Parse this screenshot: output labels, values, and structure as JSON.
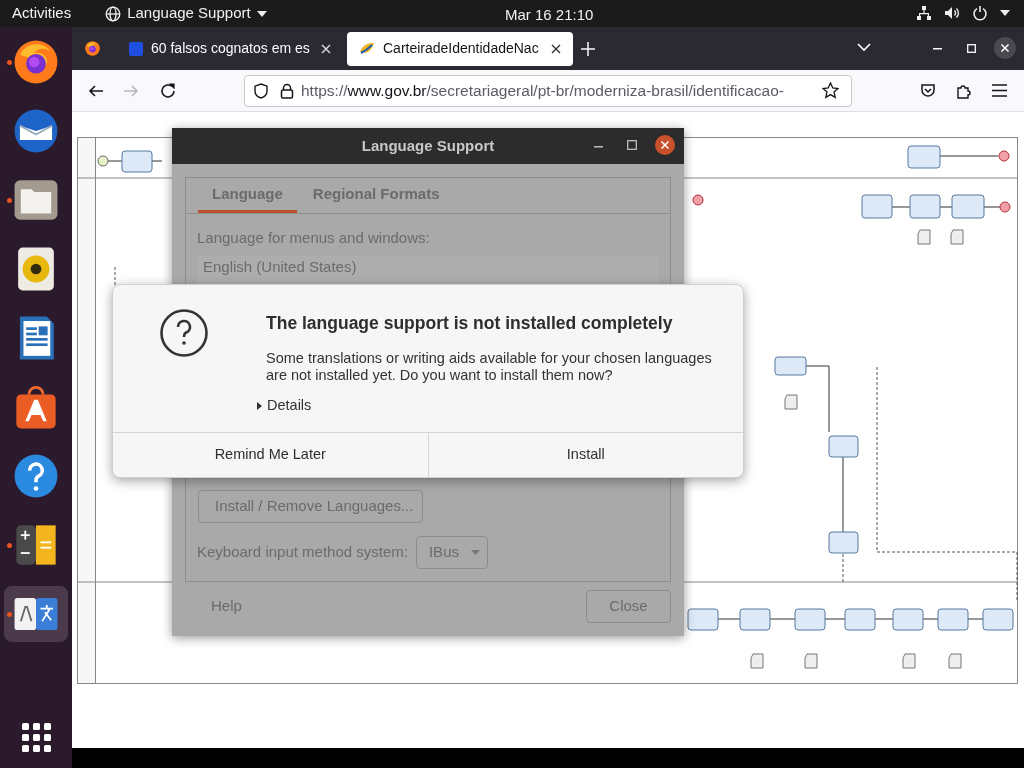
{
  "top_bar": {
    "activities": "Activities",
    "app_menu": "Language Support",
    "clock": "Mar 16  21:10"
  },
  "dock": {
    "items": [
      {
        "kind": "firefox",
        "running": true,
        "selected": false
      },
      {
        "kind": "mail",
        "running": false,
        "selected": false
      },
      {
        "kind": "files",
        "running": true,
        "selected": false
      },
      {
        "kind": "speaker",
        "running": false,
        "selected": false
      },
      {
        "kind": "document",
        "running": false,
        "selected": false
      },
      {
        "kind": "store",
        "running": false,
        "selected": false
      },
      {
        "kind": "help",
        "running": false,
        "selected": false
      },
      {
        "kind": "calculator",
        "running": true,
        "selected": false
      },
      {
        "kind": "language",
        "running": true,
        "selected": true
      }
    ]
  },
  "browser": {
    "tabs": [
      {
        "title": "60 falsos cognatos em es",
        "kind": "square",
        "selected": false
      },
      {
        "title": "CarteiradeIdentidadeNac",
        "kind": "leaf",
        "selected": true
      }
    ],
    "forward": {
      "disabled": true
    },
    "url": {
      "scheme": "https://",
      "host": "www.gov.br",
      "path": "/secretariageral/pt-br/moderniza-brasil/identificacao-"
    }
  },
  "language_window": {
    "title": "Language Support",
    "dimmed": true,
    "tabs": [
      {
        "label": "Language",
        "selected": true
      },
      {
        "label": "Regional Formats",
        "selected": false
      }
    ],
    "languages_label": "Language for menus and windows:",
    "languages": [
      "English (United States)"
    ],
    "install_button": "Install / Remove Languages...",
    "input_method_label": "Keyboard input method system:",
    "input_method": "IBus",
    "help": "Help",
    "close": "Close"
  },
  "alert": {
    "title": "The language support is not installed completely",
    "message": "Some translations or writing aids available for your chosen languages are not installed yet. Do you want to install them now?",
    "details": {
      "label": "Details",
      "expanded": false
    },
    "buttons": [
      "Remind Me Later",
      "Install"
    ]
  }
}
